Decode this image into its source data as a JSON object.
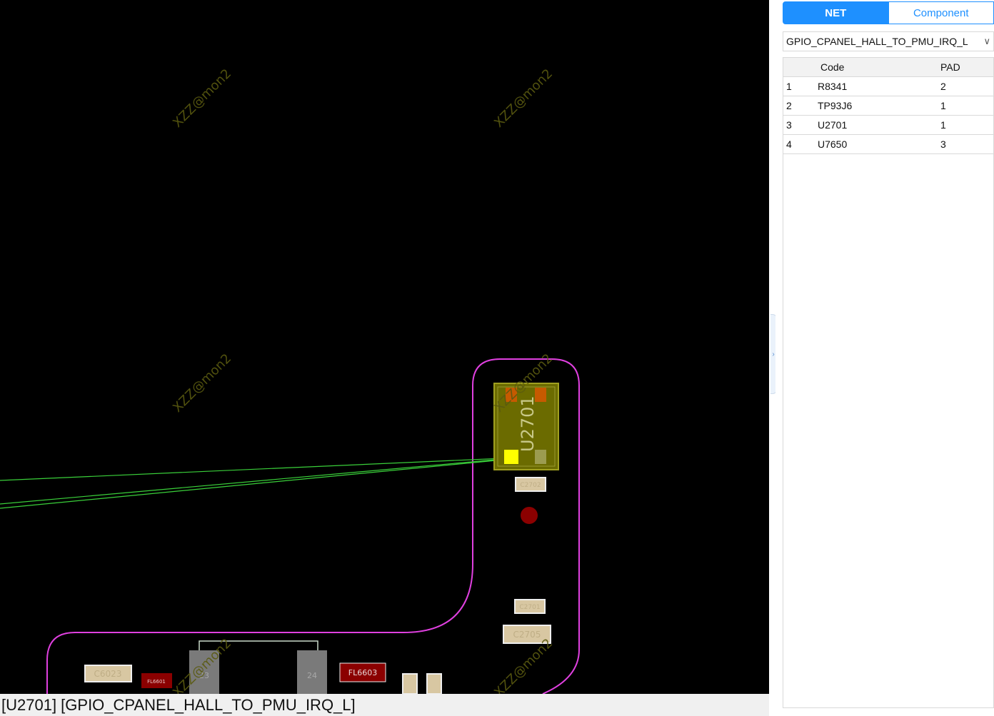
{
  "canvas": {
    "watermark": "XZZ@mon2",
    "component_label": "U2701",
    "parts": {
      "c6023": "C6023",
      "fl6601": "FL6601",
      "fl6603": "FL6603",
      "c2702": "C2702",
      "c2701": "C2701",
      "c2705": "C2705",
      "pin23": "23",
      "pin24": "24"
    },
    "colors": {
      "background": "#000000",
      "outline": "#e040e0",
      "ratsnest": "#3ad03a",
      "component_body": "#6b6b00",
      "selected_pad": "#ffff00"
    }
  },
  "status_bar": {
    "text": "[U2701] [GPIO_CPANEL_HALL_TO_PMU_IRQ_L]"
  },
  "panel": {
    "tabs": [
      {
        "label": "NET",
        "active": true
      },
      {
        "label": "Component",
        "active": false
      }
    ],
    "net_select": {
      "value": "GPIO_CPANEL_HALL_TO_PMU_IRQ_L"
    },
    "table": {
      "columns": [
        "Code",
        "PAD"
      ],
      "rows": [
        {
          "index": "1",
          "code": "R8341",
          "pad": "2"
        },
        {
          "index": "2",
          "code": "TP93J6",
          "pad": "1"
        },
        {
          "index": "3",
          "code": "U2701",
          "pad": "1"
        },
        {
          "index": "4",
          "code": "U7650",
          "pad": "3"
        }
      ]
    }
  }
}
